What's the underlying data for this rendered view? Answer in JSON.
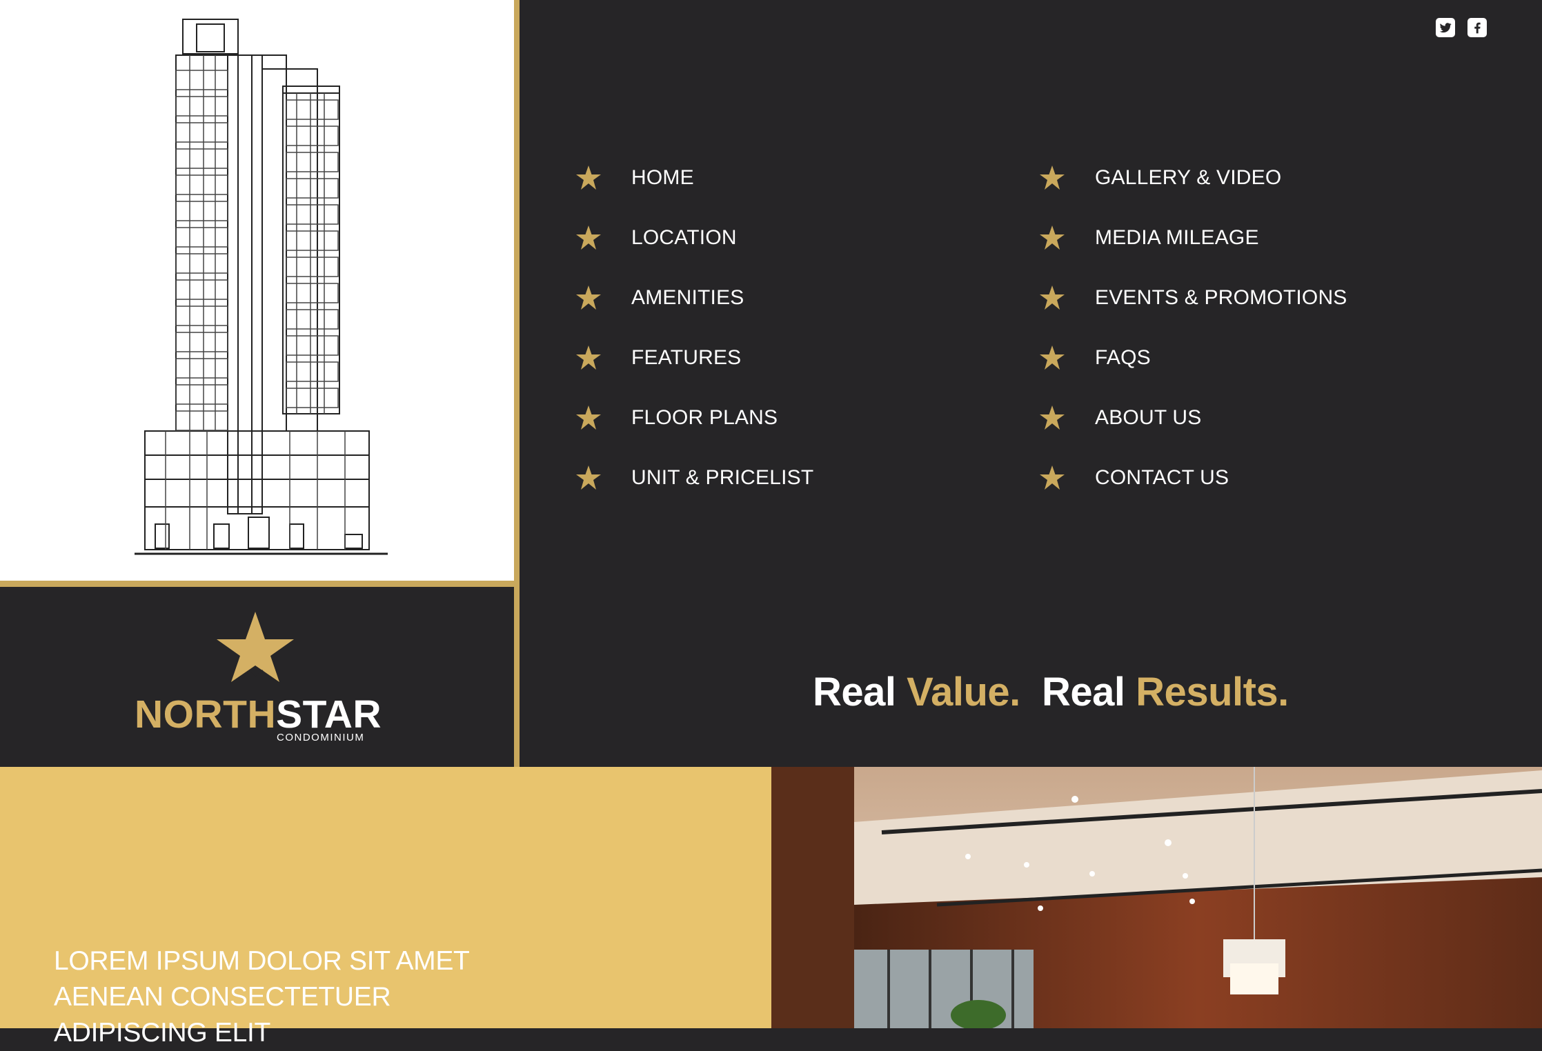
{
  "brand": {
    "name_part1": "NORTH",
    "name_part2": "STAR",
    "subtitle": "CONDOMINIUM",
    "gold_color": "#c9a85c",
    "dark_color": "#262527"
  },
  "social": [
    {
      "icon": "twitter-icon",
      "label": "Twitter"
    },
    {
      "icon": "facebook-icon",
      "label": "Facebook"
    }
  ],
  "nav": {
    "left": [
      "HOME",
      "LOCATION",
      "AMENITIES",
      "FEATURES",
      "FLOOR PLANS",
      "UNIT & PRICELIST"
    ],
    "right": [
      "GALLERY & VIDEO",
      "MEDIA MILEAGE",
      "EVENTS & PROMOTIONS",
      "FAQS",
      "ABOUT US",
      "CONTACT US"
    ],
    "bullet_icon": "star-icon"
  },
  "tagline": {
    "w1": "Real",
    "w2": "Value.",
    "w3": "Real",
    "w4": "Results."
  },
  "intro": {
    "line1": "LOREM IPSUM DOLOR SIT AMET",
    "line2": "AENEAN CONSECTETUER",
    "line3": "ADIPISCING ELIT"
  }
}
